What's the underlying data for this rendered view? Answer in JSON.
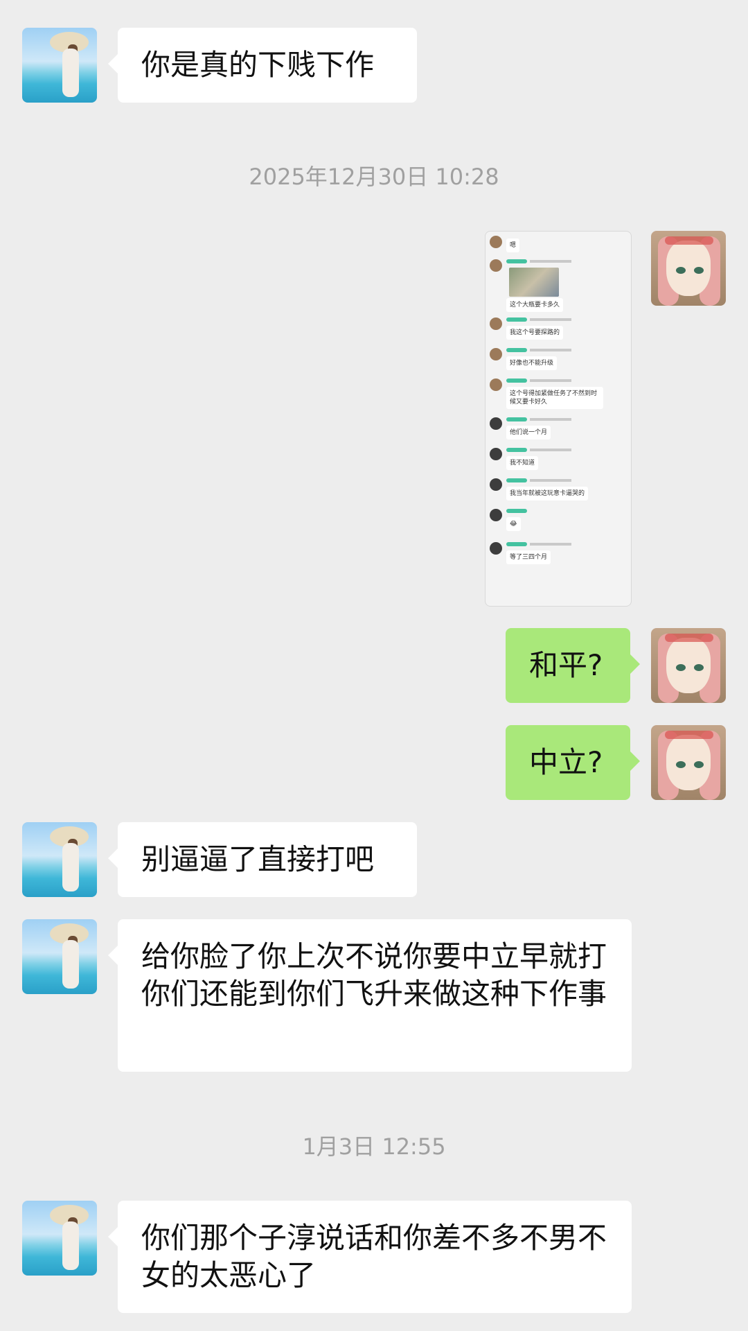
{
  "messages": [
    {
      "side": "left",
      "avatar": "beach-avatar",
      "text": "你是真的下贱下作"
    },
    {
      "type": "timestamp",
      "text": "2025年12月30日 10:28"
    },
    {
      "side": "right",
      "avatar": "anime-avatar",
      "type": "image",
      "image": {
        "rows": [
          {
            "text": "嗯"
          },
          {
            "text": "这个大瓶要卡多久",
            "has_image": true
          },
          {
            "text": "我这个号要探路的"
          },
          {
            "text": "好像也不能升级"
          },
          {
            "text": "这个号得加紧做任务了不然到时候又要卡好久"
          },
          {
            "text": "他们说一个月"
          },
          {
            "text": "我不知道"
          },
          {
            "text": "我当年就被这玩意卡逼哭的"
          },
          {
            "text": "😂"
          },
          {
            "text": "等了三四个月"
          }
        ]
      }
    },
    {
      "side": "right",
      "avatar": "anime-avatar",
      "text": "和平?"
    },
    {
      "side": "right",
      "avatar": "anime-avatar",
      "text": "中立?"
    },
    {
      "side": "left",
      "avatar": "beach-avatar",
      "text": "别逼逼了直接打吧"
    },
    {
      "side": "left",
      "avatar": "beach-avatar",
      "text": "给你脸了你上次不说你要中立早就打你们还能到你们飞升来做这种下作事"
    },
    {
      "type": "timestamp",
      "text": "1月3日 12:55"
    },
    {
      "side": "left",
      "avatar": "beach-avatar",
      "text": "你们那个子淳说话和你差不多不男不女的太恶心了"
    }
  ]
}
